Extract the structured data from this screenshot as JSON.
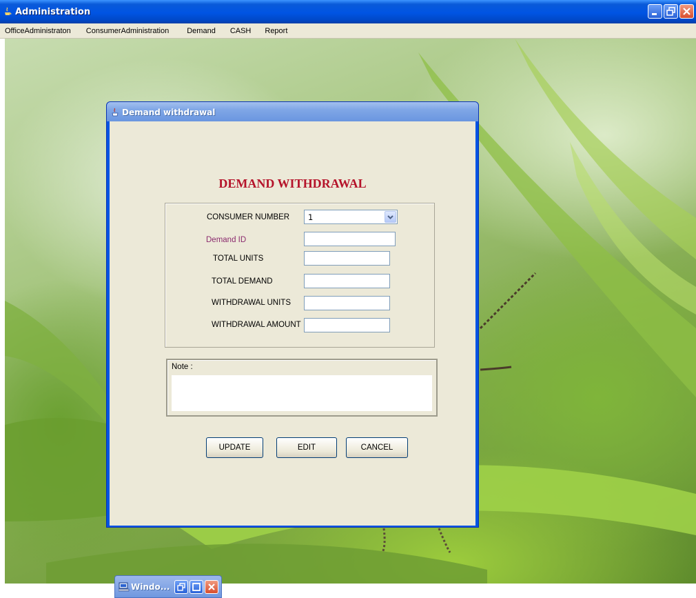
{
  "window": {
    "title": "Administration",
    "icon": "java-cup-icon",
    "controls": [
      "minimize-icon",
      "restore-icon",
      "close-icon"
    ]
  },
  "menubar": {
    "items": [
      {
        "label": "OfficeAdministraton"
      },
      {
        "label": "ConsumerAdministration"
      },
      {
        "label": "Demand"
      },
      {
        "label": "CASH"
      },
      {
        "label": "Report"
      }
    ]
  },
  "dialog": {
    "title": "Demand withdrawal",
    "icon": "java-cup-icon",
    "heading": "DEMAND WITHDRAWAL",
    "heading_color": "#b5132a",
    "fields": {
      "consumer_number": {
        "label": "CONSUMER NUMBER",
        "value": "1"
      },
      "demand_id": {
        "label": "Demand ID",
        "value": ""
      },
      "total_units": {
        "label": "TOTAL UNITS",
        "value": ""
      },
      "total_demand": {
        "label": "TOTAL DEMAND",
        "value": ""
      },
      "withdrawal_units": {
        "label": "WITHDRAWAL UNITS",
        "value": ""
      },
      "withdrawal_amount": {
        "label": "WITHDRAWAL AMOUNT",
        "value": ""
      }
    },
    "note": {
      "label": "Note :",
      "value": ""
    },
    "buttons": {
      "update": "UPDATE",
      "edit": "EDIT",
      "cancel": "CANCEL"
    }
  },
  "minimized": {
    "title": "Windo...",
    "icon": "computer-icon",
    "controls": [
      "restore-icon",
      "maximize-icon",
      "close-icon"
    ]
  },
  "colors": {
    "titlebar": "#0054e3",
    "dialog_body": "#ece9d8",
    "accent_label": "#8b2b6e"
  }
}
